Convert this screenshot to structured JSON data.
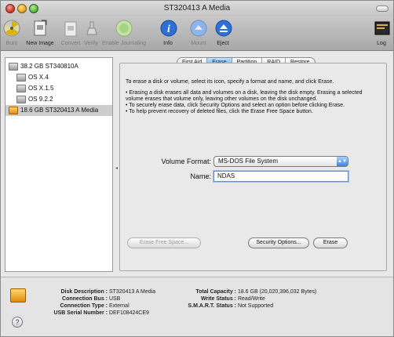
{
  "window": {
    "title": "ST320413 A Media"
  },
  "toolbar": {
    "items": [
      {
        "label": "Burn",
        "icon": "burn-icon",
        "enabled": false
      },
      {
        "label": "New Image",
        "icon": "new-image-icon",
        "enabled": true
      },
      {
        "label": "Convert",
        "icon": "convert-icon",
        "enabled": false
      },
      {
        "label": "Verify",
        "icon": "verify-icon",
        "enabled": false
      },
      {
        "label": "Enable Journaling",
        "icon": "enable-journaling-icon",
        "enabled": false
      },
      {
        "label": "Info",
        "icon": "info-icon",
        "enabled": true
      },
      {
        "label": "Mount",
        "icon": "mount-icon",
        "enabled": false
      },
      {
        "label": "Eject",
        "icon": "eject-icon",
        "enabled": true
      },
      {
        "label": "Log",
        "icon": "log-icon",
        "enabled": true
      }
    ]
  },
  "sidebar": {
    "items": [
      {
        "label": "38.2 GB ST340810A",
        "level": 0,
        "icon": "hard-disk-icon",
        "selected": false
      },
      {
        "label": "OS X.4",
        "level": 1,
        "icon": "volume-icon",
        "selected": false
      },
      {
        "label": "OS X.1.5",
        "level": 1,
        "icon": "volume-icon",
        "selected": false
      },
      {
        "label": "OS 9.2.2",
        "level": 1,
        "icon": "volume-icon",
        "selected": false
      },
      {
        "label": "18.6 GB ST320413 A Media",
        "level": 0,
        "icon": "external-disk-icon",
        "selected": true
      }
    ]
  },
  "tabs": [
    {
      "label": "First Aid",
      "active": false
    },
    {
      "label": "Erase",
      "active": true
    },
    {
      "label": "Partition",
      "active": false
    },
    {
      "label": "RAID",
      "active": false
    },
    {
      "label": "Restore",
      "active": false
    }
  ],
  "erase": {
    "intro": "To erase a disk or volume, select its icon, specify a format and name, and click Erase.",
    "bullets": [
      "• Erasing a disk erases all data and volumes on a disk, leaving the disk empty. Erasing a selected volume erases that volume only, leaving other volumes on the disk unchanged.",
      "• To securely erase data, click Security Options and select an option before clicking Erase.",
      "• To help prevent recovery of deleted files, click the Erase Free Space button."
    ],
    "volume_format_label": "Volume Format:",
    "volume_format_value": "MS-DOS File System",
    "name_label": "Name:",
    "name_value": "NDAS",
    "erase_free_space_label": "Erase Free Space...",
    "security_options_label": "Security Options...",
    "erase_label": "Erase"
  },
  "info": {
    "disk_description_label": "Disk Description :",
    "disk_description_value": "ST320413 A Media",
    "connection_bus_label": "Connection Bus :",
    "connection_bus_value": "USB",
    "connection_type_label": "Connection Type :",
    "connection_type_value": "External",
    "usb_serial_label": "USB Serial Number :",
    "usb_serial_value": "DEF108424CE9",
    "total_capacity_label": "Total Capacity :",
    "total_capacity_value": "18.6 GB (20,020,396,032 Bytes)",
    "write_status_label": "Write Status :",
    "write_status_value": "Read/Write",
    "smart_status_label": "S.M.A.R.T. Status :",
    "smart_status_value": "Not Supported",
    "help_glyph": "?"
  }
}
